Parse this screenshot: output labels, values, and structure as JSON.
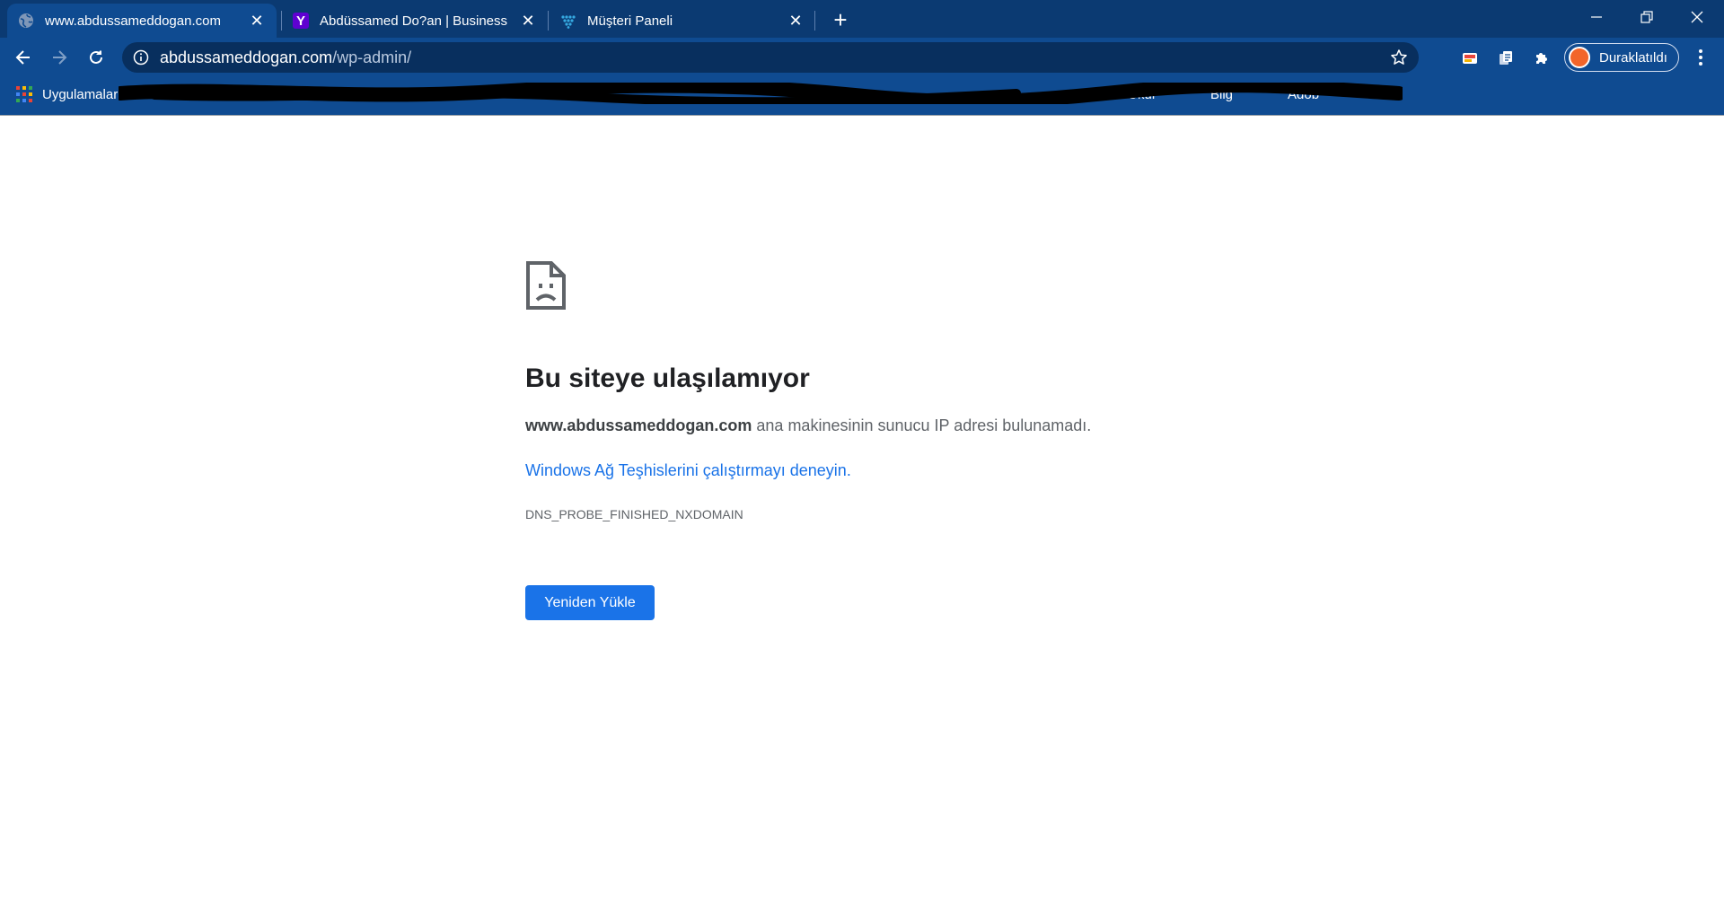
{
  "tabs": [
    {
      "title": "www.abdussameddogan.com",
      "active": true,
      "icon": "globe-icon"
    },
    {
      "title": "Abdüssamed Do?an | Business M",
      "active": false,
      "icon": "yahoo-icon",
      "icon_glyph": "Y"
    },
    {
      "title": "Müşteri Paneli",
      "active": false,
      "icon": "panel-logo-icon"
    }
  ],
  "omnibox": {
    "host": "abdussameddogan.com",
    "path": "/wp-admin/"
  },
  "profile": {
    "label": "Duraklatıldı"
  },
  "bookmarks": {
    "apps_label": "Uygulamalar",
    "partial_items": [
      "e-Okul",
      "Bilg",
      "Adob"
    ]
  },
  "error": {
    "icon": "sad-page-icon",
    "title": "Bu siteye ulaşılamıyor",
    "host": "www.abdussameddogan.com",
    "description": "ana makinesinin sunucu IP adresi bulunamadı.",
    "link": "Windows Ağ Teşhislerini çalıştırmayı deneyin.",
    "code": "DNS_PROBE_FINISHED_NXDOMAIN",
    "reload_label": "Yeniden Yükle"
  },
  "colors": {
    "tabstrip": "#0b3a72",
    "toolbar": "#0f4b91",
    "link": "#1a73e8",
    "button": "#1a73e8"
  }
}
